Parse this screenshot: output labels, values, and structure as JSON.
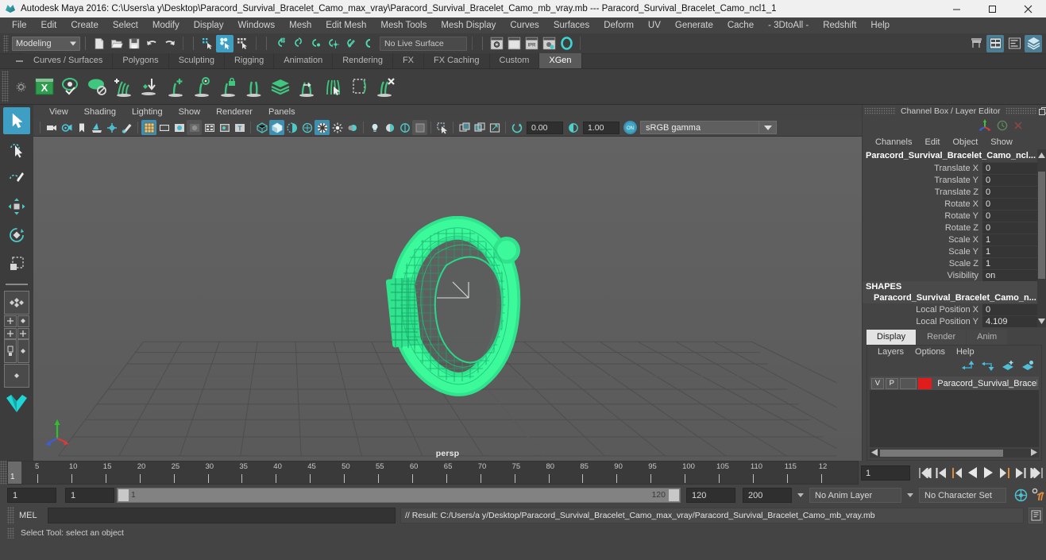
{
  "window": {
    "title": "Autodesk Maya 2016: C:\\Users\\a y\\Desktop\\Paracord_Survival_Bracelet_Camo_max_vray\\Paracord_Survival_Bracelet_Camo_mb_vray.mb  ---  Paracord_Survival_Bracelet_Camo_ncl1_1",
    "minimize": "minimize-button",
    "maximize": "maximize-button",
    "close": "close-button"
  },
  "menubar": {
    "items": [
      "File",
      "Edit",
      "Create",
      "Select",
      "Modify",
      "Display",
      "Windows",
      "Mesh",
      "Edit Mesh",
      "Mesh Tools",
      "Mesh Display",
      "Curves",
      "Surfaces",
      "Deform",
      "UV",
      "Generate",
      "Cache",
      "- 3DtoAll -",
      "Redshift",
      "Help"
    ]
  },
  "statusline": {
    "mode": "Modeling",
    "live_surface": "No Live Surface"
  },
  "shelf_tabs": {
    "items": [
      "Curves / Surfaces",
      "Polygons",
      "Sculpting",
      "Rigging",
      "Animation",
      "Rendering",
      "FX",
      "FX Caching",
      "Custom",
      "XGen"
    ],
    "active": "XGen"
  },
  "viewport": {
    "menus": [
      "View",
      "Shading",
      "Lighting",
      "Show",
      "Renderer",
      "Panels"
    ],
    "exposure": "0.00",
    "gamma": "1.00",
    "color_profile": "sRGB gamma",
    "camera_label": "persp"
  },
  "channel_box": {
    "panel_title": "Channel Box / Layer Editor",
    "menus": [
      "Channels",
      "Edit",
      "Object",
      "Show"
    ],
    "object_name": "Paracord_Survival_Bracelet_Camo_ncl...",
    "attributes": [
      {
        "label": "Translate X",
        "value": "0"
      },
      {
        "label": "Translate Y",
        "value": "0"
      },
      {
        "label": "Translate Z",
        "value": "0"
      },
      {
        "label": "Rotate X",
        "value": "0"
      },
      {
        "label": "Rotate Y",
        "value": "0"
      },
      {
        "label": "Rotate Z",
        "value": "0"
      },
      {
        "label": "Scale X",
        "value": "1"
      },
      {
        "label": "Scale Y",
        "value": "1"
      },
      {
        "label": "Scale Z",
        "value": "1"
      },
      {
        "label": "Visibility",
        "value": "on"
      }
    ],
    "shapes_header": "SHAPES",
    "shape_name": "Paracord_Survival_Bracelet_Camo_n...",
    "shape_attributes": [
      {
        "label": "Local Position X",
        "value": "0"
      },
      {
        "label": "Local Position Y",
        "value": "4.109"
      }
    ]
  },
  "layer_editor": {
    "tabs": [
      "Display",
      "Render",
      "Anim"
    ],
    "active_tab": "Display",
    "menus": [
      "Layers",
      "Options",
      "Help"
    ],
    "layers": [
      {
        "visibility": "V",
        "playback": "P",
        "type": "",
        "color": "#e01c1c",
        "name": "Paracord_Survival_Bracel"
      }
    ]
  },
  "timeline": {
    "ticks": [
      "5",
      "10",
      "15",
      "20",
      "25",
      "30",
      "35",
      "40",
      "45",
      "50",
      "55",
      "60",
      "65",
      "70",
      "75",
      "80",
      "85",
      "90",
      "95",
      "100",
      "105",
      "110",
      "115",
      "12"
    ],
    "current_frame": "1",
    "frame_field": "1"
  },
  "playback_range": {
    "start_field": "1",
    "anim_start_field": "1",
    "range_start": "1",
    "range_end": "120",
    "end_field": "120",
    "anim_end_field": "200",
    "anim_layer": "No Anim Layer",
    "character_set": "No Character Set"
  },
  "command_line": {
    "label": "MEL",
    "input_value": "",
    "result": "// Result: C:/Users/a y/Desktop/Paracord_Survival_Bracelet_Camo_max_vray/Paracord_Survival_Bracelet_Camo_mb_vray.mb"
  },
  "help_line": {
    "text": "Select Tool: select an object"
  },
  "colors": {
    "accent_blue": "#3f9ec4",
    "shelf_green": "#3fc77f",
    "model_green": "#3aff9c",
    "layer_red": "#e01c1c",
    "titlebar_bg": "#f0f0f0",
    "panel_bg": "#444444",
    "viewport_bg": "#5d5d5d"
  }
}
